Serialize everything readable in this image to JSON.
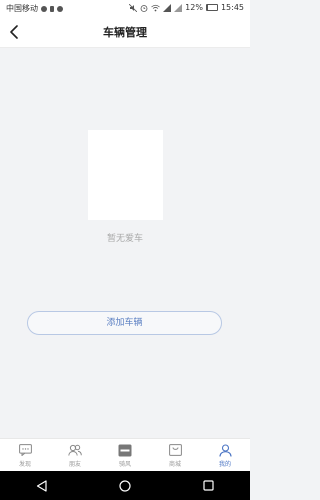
{
  "status_bar": {
    "carrier": "中国移动",
    "battery": "12%",
    "battery_level": 0.12,
    "time": "15:45"
  },
  "header": {
    "title": "车辆管理",
    "back_icon": "chevron-left-icon"
  },
  "empty_state": {
    "message": "暂无爱车"
  },
  "actions": {
    "add_vehicle": "添加车辆"
  },
  "tabs": [
    {
      "label": "发现",
      "icon": "chat-icon",
      "active": false
    },
    {
      "label": "朋友",
      "icon": "friends-icon",
      "active": false
    },
    {
      "label": "骑风",
      "icon": "ride-icon",
      "active": false
    },
    {
      "label": "商城",
      "icon": "shop-icon",
      "active": false
    },
    {
      "label": "我的",
      "icon": "profile-icon",
      "active": true
    }
  ],
  "colors": {
    "accent": "#4a74c4",
    "background": "#f2f3f5"
  }
}
